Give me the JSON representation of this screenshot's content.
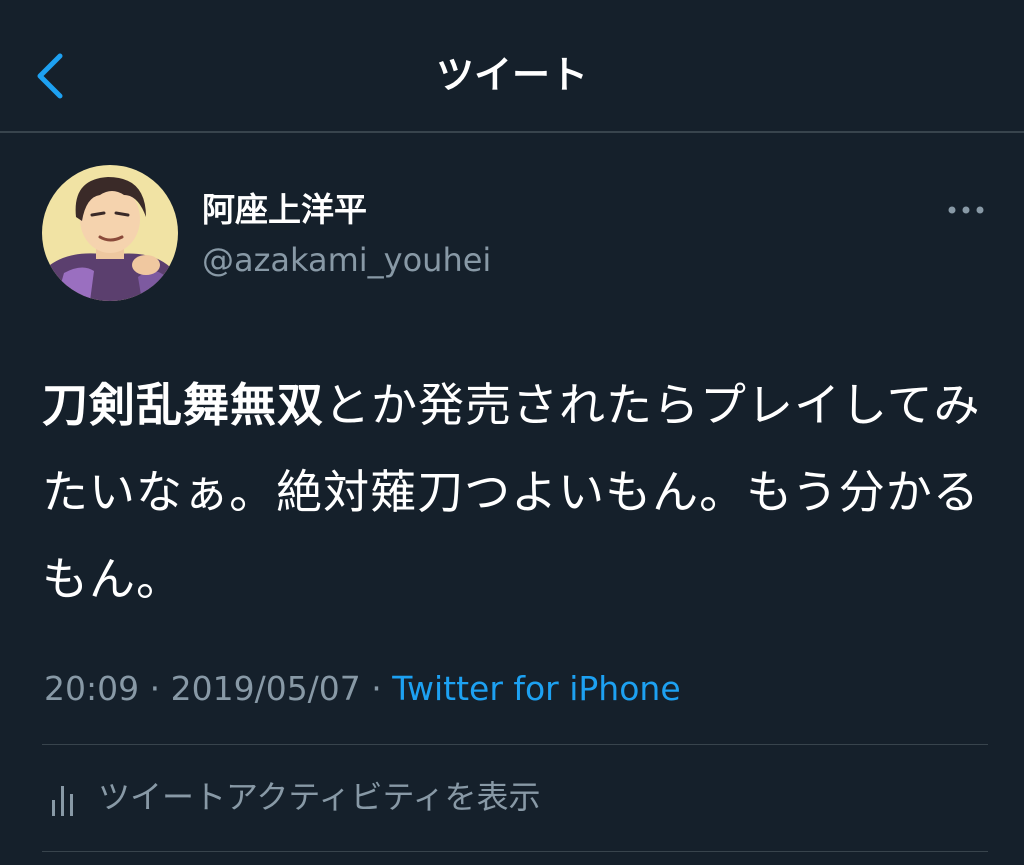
{
  "colors": {
    "background": "#15202b",
    "divider": "#38444d",
    "secondary_text": "#8899a6",
    "accent": "#1da1f2",
    "primary_text": "#ffffff"
  },
  "header": {
    "back_icon": "chevron-left-icon",
    "title": "ツイート"
  },
  "tweet": {
    "author": {
      "avatar_icon": "avatar",
      "display_name": "阿座上洋平",
      "handle": "@azakami_youhei"
    },
    "more_icon": "more-horizontal-icon",
    "text_bold": "刀剣乱舞無双",
    "text_rest": "とか発売されたらプレイしてみたいなぁ。絶対薙刀つよいもん。もう分かるもん。",
    "time": "20:09",
    "separator1": " · ",
    "date": "2019/05/07",
    "separator2": " · ",
    "source": "Twitter for iPhone"
  },
  "activity": {
    "icon": "bar-chart-icon",
    "label": "ツイートアクティビティを表示"
  }
}
